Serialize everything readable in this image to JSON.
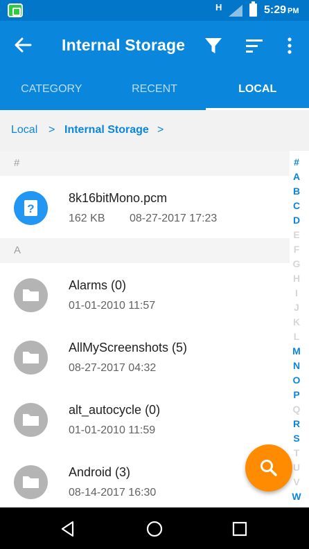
{
  "status_bar": {
    "network": "H",
    "time": "5:29",
    "ampm": "PM"
  },
  "app_bar": {
    "title": "Internal Storage"
  },
  "tabs": [
    {
      "label": "CATEGORY",
      "active": false
    },
    {
      "label": "RECENT",
      "active": false
    },
    {
      "label": "LOCAL",
      "active": true
    }
  ],
  "breadcrumb": {
    "items": [
      "Local",
      ">",
      "Internal Storage",
      ">"
    ]
  },
  "sections": [
    {
      "header": "#",
      "items": [
        {
          "name": "8k16bitMono.pcm",
          "size": "162 KB",
          "date": "08-27-2017 17:23",
          "icon": "unknown-file-icon"
        }
      ]
    },
    {
      "header": "A",
      "items": [
        {
          "name": "Alarms (0)",
          "date": "01-01-2010 11:57",
          "icon": "folder-icon"
        },
        {
          "name": "AllMyScreenshots (5)",
          "date": "08-27-2017 04:32",
          "icon": "folder-icon"
        },
        {
          "name": "alt_autocycle (0)",
          "date": "01-01-2010 11:59",
          "icon": "folder-icon"
        },
        {
          "name": "Android (3)",
          "date": "08-14-2017 16:30",
          "icon": "folder-icon"
        }
      ]
    }
  ],
  "alpha_index": [
    {
      "letter": "#",
      "active": true
    },
    {
      "letter": "A",
      "active": true
    },
    {
      "letter": "B",
      "active": true
    },
    {
      "letter": "C",
      "active": true
    },
    {
      "letter": "D",
      "active": true
    },
    {
      "letter": "E",
      "active": false
    },
    {
      "letter": "F",
      "active": false
    },
    {
      "letter": "G",
      "active": false
    },
    {
      "letter": "H",
      "active": false
    },
    {
      "letter": "I",
      "active": false
    },
    {
      "letter": "J",
      "active": false
    },
    {
      "letter": "K",
      "active": false
    },
    {
      "letter": "L",
      "active": false
    },
    {
      "letter": "M",
      "active": true
    },
    {
      "letter": "N",
      "active": true
    },
    {
      "letter": "O",
      "active": true
    },
    {
      "letter": "P",
      "active": true
    },
    {
      "letter": "Q",
      "active": false
    },
    {
      "letter": "R",
      "active": true
    },
    {
      "letter": "S",
      "active": true
    },
    {
      "letter": "T",
      "active": false
    },
    {
      "letter": "U",
      "active": false
    },
    {
      "letter": "V",
      "active": false
    },
    {
      "letter": "W",
      "active": true
    }
  ],
  "colors": {
    "primary": "#0a86dc",
    "status_bar": "#0277c9",
    "fab": "#ff8c00",
    "folder": "#b4b4b4",
    "unknown_file": "#2196f3"
  },
  "icons": {
    "back": "arrow-left-icon",
    "filter": "filter-icon",
    "sort": "sort-icon",
    "more": "more-vert-icon",
    "fab": "search-icon",
    "nav_back": "nav-back-icon",
    "nav_home": "nav-home-icon",
    "nav_recents": "nav-recents-icon"
  }
}
